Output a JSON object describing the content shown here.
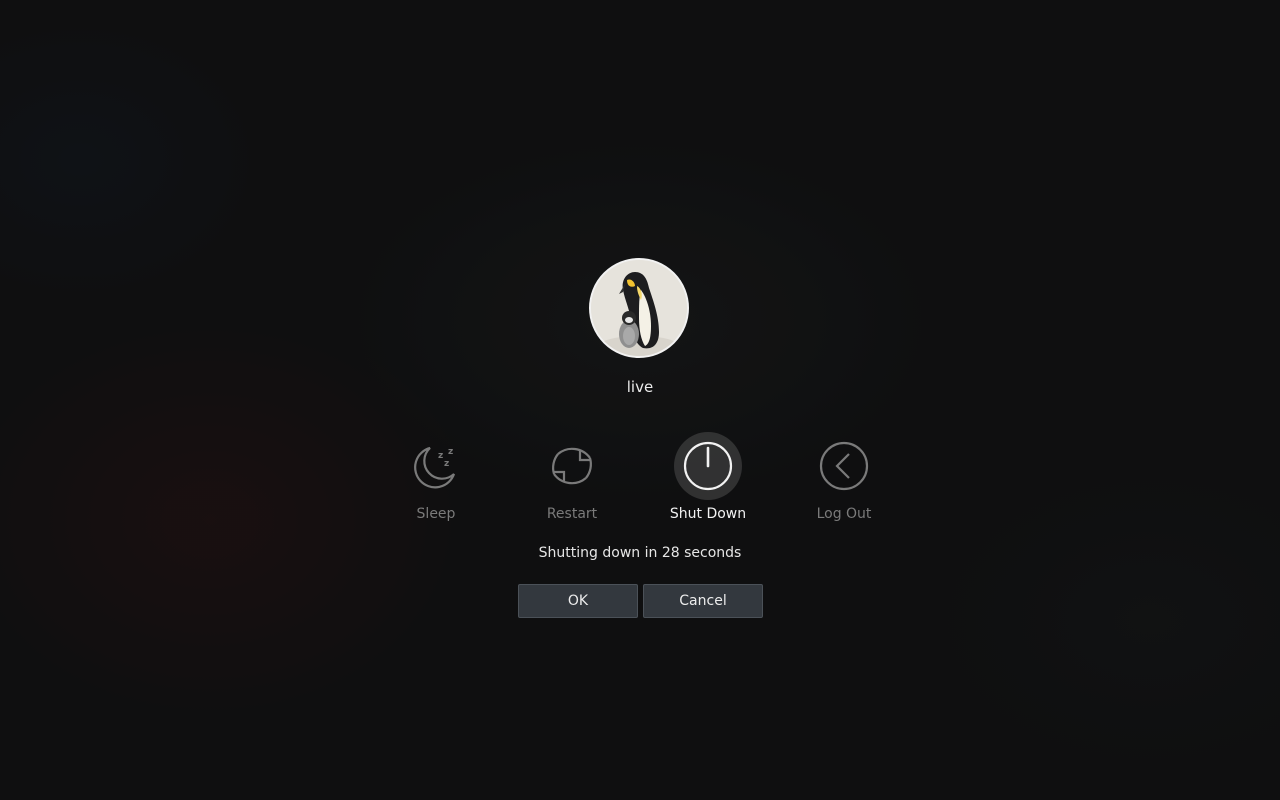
{
  "user": {
    "name": "live",
    "avatar_icon": "penguin-avatar-icon"
  },
  "actions": [
    {
      "label": "Sleep",
      "icon": "sleep-moon-icon",
      "active": false
    },
    {
      "label": "Restart",
      "icon": "restart-icon",
      "active": false
    },
    {
      "label": "Shut Down",
      "icon": "power-icon",
      "active": true
    },
    {
      "label": "Log Out",
      "icon": "log-out-chevron-icon",
      "active": false
    }
  ],
  "status_text": "Shutting down in 28 seconds",
  "buttons": {
    "ok_label": "OK",
    "cancel_label": "Cancel"
  },
  "colors": {
    "background": "#141516",
    "active_label": "#f2f2f2",
    "inactive_label": "#7a7a7a",
    "button_bg": "#33383e"
  }
}
